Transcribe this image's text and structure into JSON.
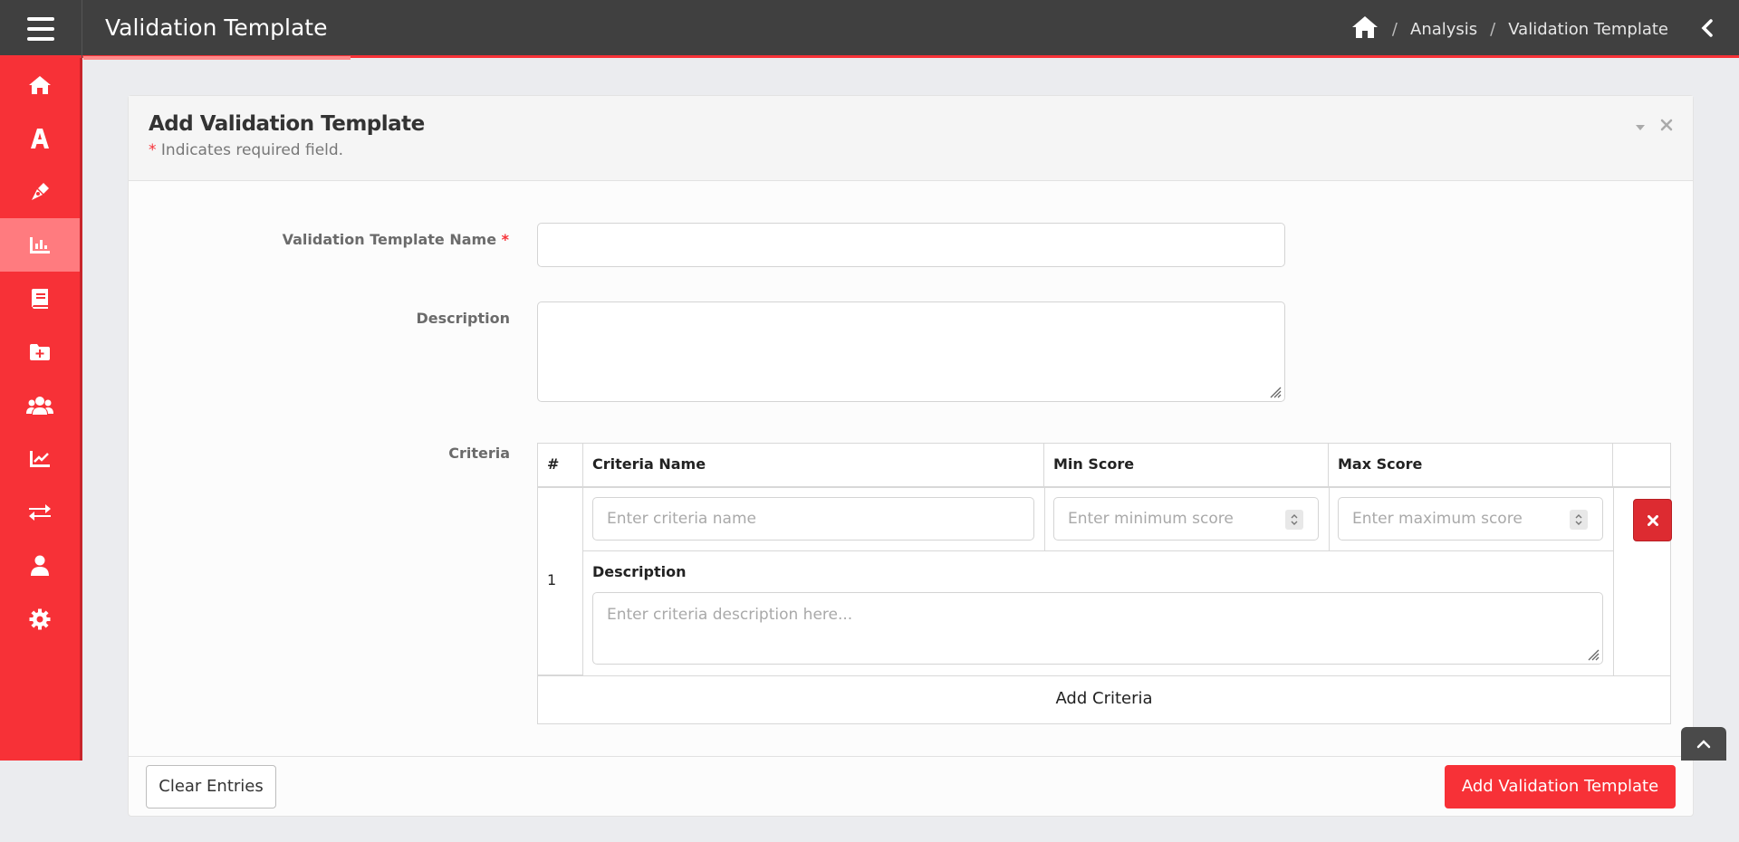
{
  "header": {
    "title": "Validation Template",
    "breadcrumb": [
      "Analysis",
      "Validation Template"
    ],
    "separator": "/"
  },
  "sidebar": {
    "items": [
      {
        "icon": "home-icon"
      },
      {
        "icon": "font-icon"
      },
      {
        "icon": "pen-nib-icon"
      },
      {
        "icon": "chart-bar-icon",
        "active": true
      },
      {
        "icon": "book-icon"
      },
      {
        "icon": "folder-plus-icon"
      },
      {
        "icon": "users-icon"
      },
      {
        "icon": "chart-line-icon"
      },
      {
        "icon": "exchange-icon"
      },
      {
        "icon": "user-icon"
      },
      {
        "icon": "cog-icon"
      }
    ]
  },
  "card": {
    "title": "Add Validation Template",
    "required_star": "*",
    "required_note": "Indicates required field."
  },
  "form": {
    "name_label": "Validation Template Name",
    "name_value": "",
    "description_label": "Description",
    "description_value": "",
    "criteria_label": "Criteria"
  },
  "criteria_table": {
    "headers": [
      "#",
      "Criteria Name",
      "Min Score",
      "Max Score"
    ],
    "rows": [
      {
        "index": "1",
        "name_placeholder": "Enter criteria name",
        "min_placeholder": "Enter minimum score",
        "max_placeholder": "Enter maximum score",
        "description_label": "Description",
        "description_placeholder": "Enter criteria description here..."
      }
    ],
    "add_label": "Add Criteria"
  },
  "footer": {
    "clear_label": "Clear Entries",
    "submit_label": "Add Validation Template"
  },
  "colors": {
    "accent": "#f73137",
    "topbar": "#404040",
    "sidebar_active": "#ff7b7f",
    "delete": "#dd2b31"
  }
}
